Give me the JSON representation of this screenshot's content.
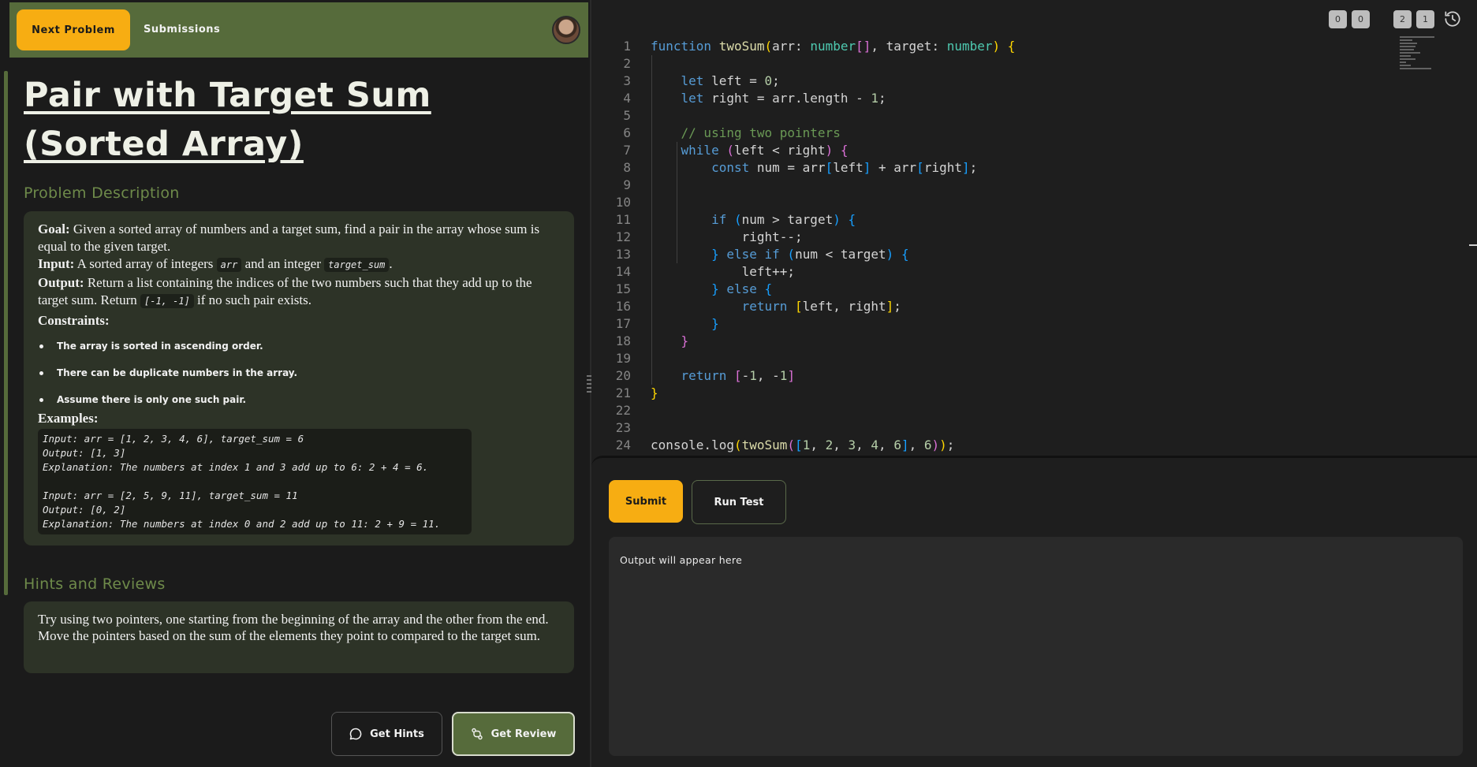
{
  "header": {
    "next_problem_label": "Next Problem",
    "submissions_label": "Submissions"
  },
  "problem": {
    "title": "Pair with Target Sum (Sorted Array)",
    "description_heading": "Problem Description",
    "goal_label": "Goal:",
    "goal_text": "Given a sorted array of numbers and a target sum, find a pair in the array whose sum is equal to the given target.",
    "input_label": "Input:",
    "input_text_1": "A sorted array of integers",
    "input_code_1": "arr",
    "input_text_2": "and an integer",
    "input_code_2": "target_sum",
    "input_text_3": ".",
    "output_label": "Output:",
    "output_text_1": "Return a list containing the indices of the two numbers such that they add up to the target sum. Return",
    "output_code": "[-1, -1]",
    "output_text_2": "if no such pair exists.",
    "constraints_label": "Constraints:",
    "constraints": [
      "The array is sorted in ascending order.",
      "There can be duplicate numbers in the array.",
      "Assume there is only one such pair."
    ],
    "examples_label": "Examples:",
    "examples_text": "Input: arr = [1, 2, 3, 4, 6], target_sum = 6\nOutput: [1, 3]\nExplanation: The numbers at index 1 and 3 add up to 6: 2 + 4 = 6.\n\nInput: arr = [2, 5, 9, 11], target_sum = 11\nOutput: [0, 2]\nExplanation: The numbers at index 0 and 2 add up to 11: 2 + 9 = 11."
  },
  "hints": {
    "heading": "Hints and Reviews",
    "text": "Try using two pointers, one starting from the beginning of the array and the other from the end. Move the pointers based on the sum of the elements they point to compared to the target sum."
  },
  "actions": {
    "get_hints_label": "Get Hints",
    "get_review_label": "Get Review"
  },
  "editor": {
    "counters": [
      "0",
      "0",
      "2",
      "1"
    ],
    "line_numbers": [
      "1",
      "2",
      "3",
      "4",
      "5",
      "6",
      "7",
      "8",
      "9",
      "10",
      "11",
      "12",
      "13",
      "14",
      "15",
      "16",
      "17",
      "18",
      "19",
      "20",
      "21",
      "22",
      "23",
      "24"
    ]
  },
  "runner": {
    "submit_label": "Submit",
    "run_test_label": "Run Test",
    "output_placeholder": "Output will appear here"
  },
  "icons": {
    "hints": "chat-bubble-icon",
    "review": "git-compare-icon",
    "history": "history-icon"
  },
  "colors": {
    "accent_yellow": "#f7ad12",
    "accent_green": "#566b3b",
    "heading_green": "#6e8a4a"
  }
}
